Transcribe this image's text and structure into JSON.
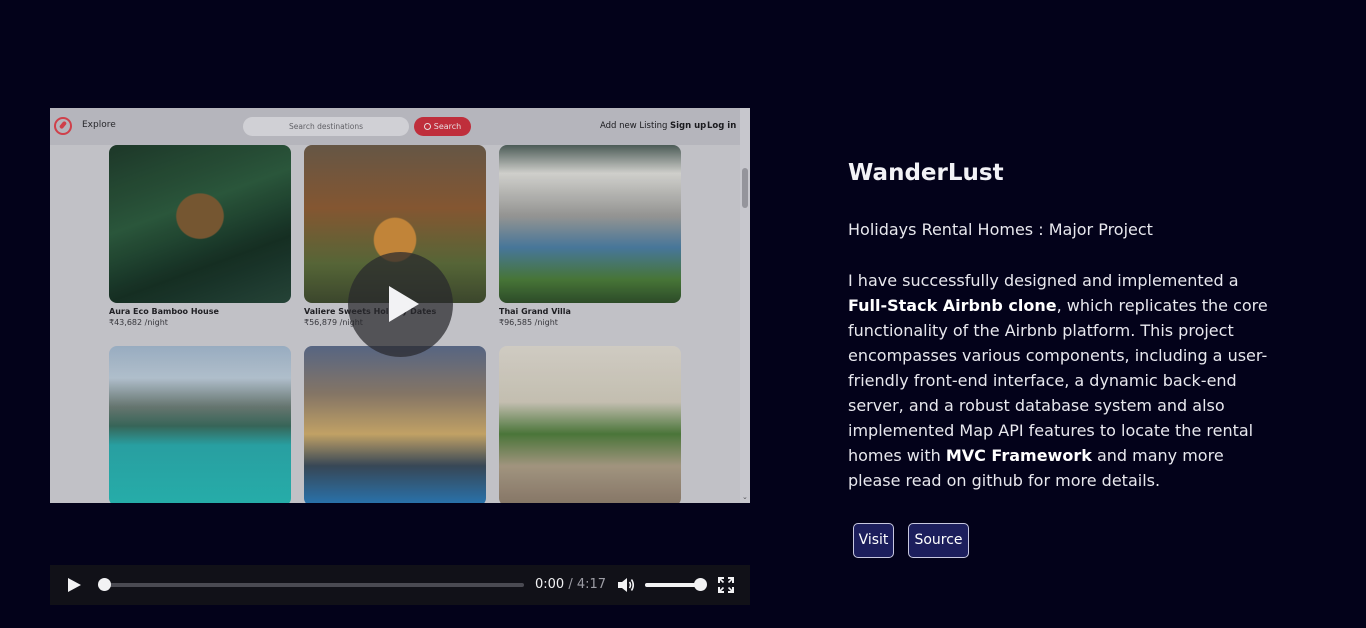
{
  "video": {
    "app": {
      "nav": {
        "explore": "Explore",
        "search_placeholder": "Search destinations",
        "search_button": "Search",
        "add_listing": "Add new Listing",
        "sign_up": "Sign up",
        "log_in": "Log in"
      },
      "listings": [
        {
          "title": "Aura Eco Bamboo House",
          "price": "₹43,682 /night"
        },
        {
          "title": "Valiere Sweets Holiday Dates",
          "price": "₹56,879 /night"
        },
        {
          "title": "Thai Grand Villa",
          "price": "₹96,585 /night"
        },
        {
          "title": "",
          "price": ""
        },
        {
          "title": "",
          "price": ""
        },
        {
          "title": "",
          "price": ""
        }
      ]
    },
    "controls": {
      "current_time": "0:00",
      "separator": "/",
      "duration": "4:17",
      "progress": 0.0,
      "volume": 1.0
    }
  },
  "project": {
    "title": "WanderLust",
    "subtitle": "Holidays Rental Homes : Major Project",
    "description": {
      "part1": "I have successfully designed and implemented a ",
      "bold1": "Full-Stack Airbnb clone",
      "part2": ", which replicates the core functionality of the Airbnb platform. This project encompasses various components, including a user-friendly front-end interface, a dynamic back-end server, and a robust database system and also implemented Map API features to locate the rental homes with ",
      "bold2": "MVC Framework",
      "part3": " and many more please read on github for more details."
    },
    "buttons": {
      "visit": "Visit",
      "source": "Source"
    }
  }
}
